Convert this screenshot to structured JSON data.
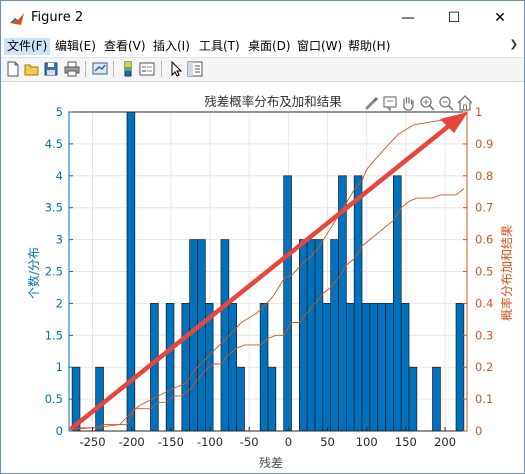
{
  "window": {
    "title": "Figure 2",
    "controls": {
      "minimize": "—",
      "maximize": "☐",
      "close": "✕"
    }
  },
  "menu": {
    "items": [
      {
        "label": "文件(F)"
      },
      {
        "label": "编辑(E)"
      },
      {
        "label": "查看(V)"
      },
      {
        "label": "插入(I)"
      },
      {
        "label": "工具(T)"
      },
      {
        "label": "桌面(D)"
      },
      {
        "label": "窗口(W)"
      },
      {
        "label": "帮助(H)"
      }
    ],
    "overflow_icon": "chevron-right-icon"
  },
  "toolbar": {
    "icons": [
      "new-figure-icon",
      "open-icon",
      "save-icon",
      "print-icon",
      "link-plot-icon",
      "colorbar-icon",
      "legend-icon",
      "pointer-icon",
      "property-inspector-icon"
    ]
  },
  "axes_toolbar": {
    "icons": [
      "brush-icon",
      "datatip-icon",
      "pan-icon",
      "zoom-in-icon",
      "zoom-out-icon",
      "home-icon"
    ]
  },
  "colors": {
    "bar_fill": "#0072BD",
    "left_axis": "#0072BD",
    "right_axis": "#D95319",
    "arrow": "#E8453C"
  },
  "chart_data": {
    "type": "bar",
    "title": "残差概率分布及加和结果",
    "xlabel": "残差",
    "ylabel": "个数/分布",
    "ylabel_right": "概率分布加和结果",
    "xlim": [
      -280,
      228
    ],
    "ylim": [
      0,
      5
    ],
    "ylim_right": [
      0,
      1
    ],
    "grid": true,
    "xticks": [
      -250,
      -200,
      -150,
      -100,
      -50,
      0,
      50,
      100,
      150,
      200
    ],
    "yticks": [
      "0",
      "0.5",
      "1",
      "1.5",
      "2",
      "2.5",
      "3",
      "3.5",
      "4",
      "4.5",
      "5"
    ],
    "yticks_right": [
      "0",
      "0.1",
      "0.2",
      "0.3",
      "0.4",
      "0.5",
      "0.6",
      "0.7",
      "0.8",
      "0.9",
      "1"
    ],
    "bin_edges": [
      -276,
      -266,
      -256,
      -246,
      -236,
      -226,
      -216,
      -206,
      -196,
      -186,
      -176,
      -166,
      -156,
      -146,
      -136,
      -126,
      -116,
      -106,
      -96,
      -86,
      -76,
      -66,
      -56,
      -46,
      -36,
      -26,
      -16,
      -6,
      4,
      14,
      24,
      34,
      44,
      54,
      64,
      74,
      84,
      94,
      104,
      114,
      124,
      134,
      144,
      154,
      164,
      174,
      184,
      194,
      204,
      214,
      224
    ],
    "counts": [
      1,
      0,
      0,
      1,
      0,
      0,
      0,
      5,
      0,
      0,
      2,
      0,
      2,
      0,
      2,
      3,
      3,
      2,
      0,
      3,
      2,
      1,
      0,
      0,
      2,
      1,
      0,
      4,
      0,
      3,
      3,
      3,
      2,
      3,
      4,
      2,
      4,
      2,
      2,
      2,
      2,
      4,
      2,
      1,
      0,
      0,
      1,
      0,
      0,
      2
    ],
    "cumulative_curve": {
      "x": [
        -276,
        -266,
        -256,
        -246,
        -236,
        -226,
        -216,
        -206,
        -196,
        -186,
        -176,
        -166,
        -156,
        -146,
        -136,
        -126,
        -116,
        -106,
        -96,
        -86,
        -76,
        -66,
        -56,
        -46,
        -36,
        -26,
        -16,
        -6,
        4,
        14,
        24,
        34,
        44,
        54,
        64,
        74,
        84,
        94,
        104,
        114,
        124,
        134,
        144,
        154,
        164,
        174,
        184,
        194,
        204,
        214,
        224
      ],
      "y": [
        0,
        0.01,
        0.01,
        0.01,
        0.02,
        0.02,
        0.02,
        0.02,
        0.07,
        0.07,
        0.07,
        0.09,
        0.09,
        0.11,
        0.11,
        0.13,
        0.16,
        0.19,
        0.21,
        0.21,
        0.24,
        0.26,
        0.27,
        0.27,
        0.27,
        0.29,
        0.3,
        0.3,
        0.34,
        0.34,
        0.37,
        0.4,
        0.43,
        0.45,
        0.48,
        0.52,
        0.54,
        0.58,
        0.6,
        0.62,
        0.64,
        0.66,
        0.7,
        0.72,
        0.73,
        0.73,
        0.73,
        0.74,
        0.74,
        0.74,
        0.76
      ]
    },
    "cumulative_smooth": {
      "x": [
        -280,
        -250,
        -215,
        -200,
        -190,
        -150,
        -130,
        -120,
        -100,
        -75,
        -60,
        -40,
        -20,
        -5,
        5,
        20,
        30,
        40,
        50,
        60,
        65,
        75,
        85,
        95,
        100,
        110,
        125,
        140,
        160,
        185,
        210,
        225
      ],
      "y": [
        0.005,
        0.01,
        0.02,
        0.06,
        0.08,
        0.13,
        0.15,
        0.19,
        0.24,
        0.3,
        0.34,
        0.37,
        0.42,
        0.48,
        0.49,
        0.53,
        0.55,
        0.58,
        0.62,
        0.66,
        0.68,
        0.72,
        0.76,
        0.79,
        0.82,
        0.85,
        0.89,
        0.93,
        0.96,
        0.97,
        0.98,
        0.99
      ]
    }
  }
}
